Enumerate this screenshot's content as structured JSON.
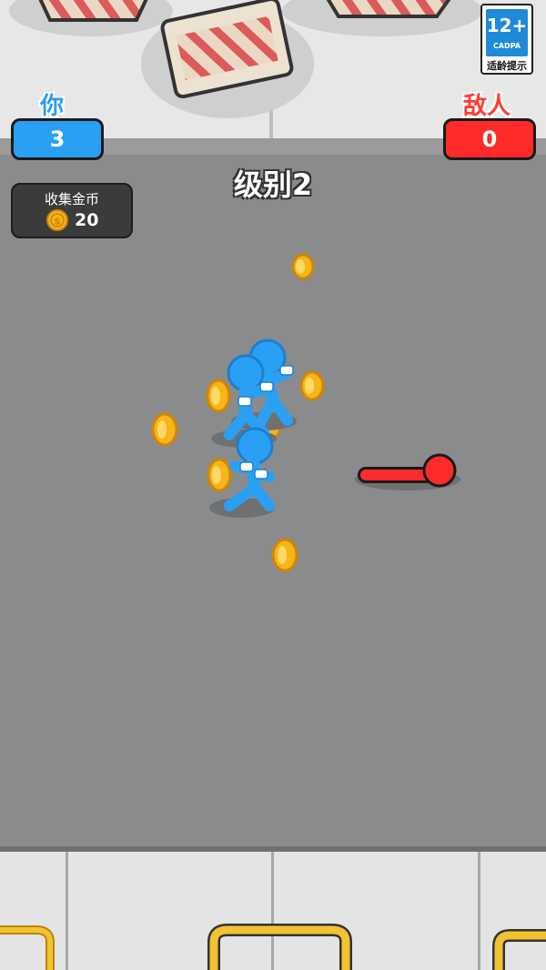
{
  "player": {
    "label": "你",
    "score": "3",
    "color": "#2aa0f5"
  },
  "enemy": {
    "label": "敌人",
    "score": "0",
    "color": "#ff2a2a"
  },
  "level": {
    "title": "级别2"
  },
  "coins_panel": {
    "label": "收集金币",
    "count": "20",
    "coin_symbol": "$"
  },
  "age_rating": {
    "age": "12+",
    "org": "CADPA",
    "tip": "适龄提示"
  },
  "colors": {
    "floor": "#8a8b8c",
    "wall": "#e7e7e7",
    "coin": "#f6b518"
  }
}
